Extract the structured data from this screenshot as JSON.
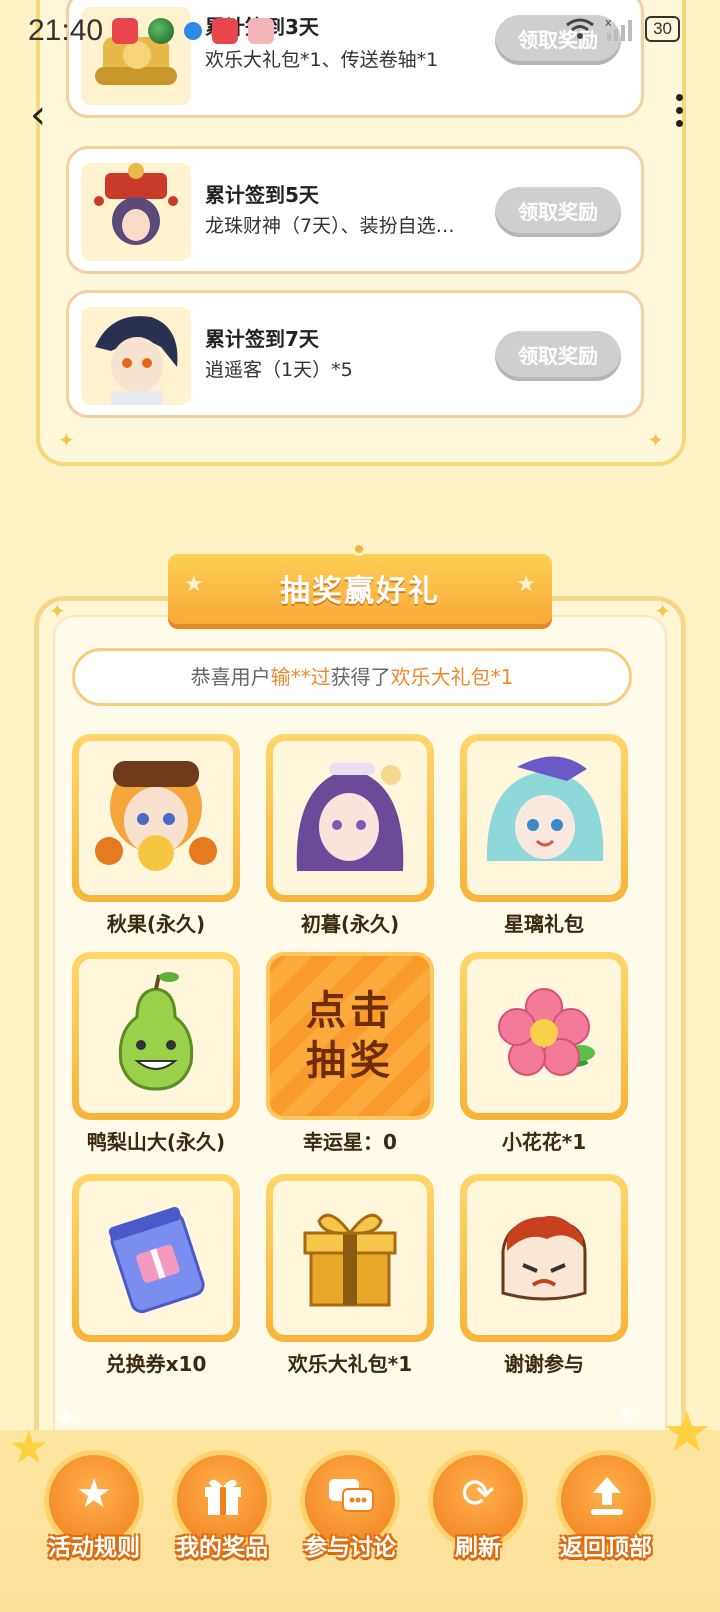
{
  "status_bar": {
    "time": "21:40",
    "battery": "30"
  },
  "signin_cards": [
    {
      "title": "累计签到3天",
      "desc": "欢乐大礼包*1、传送卷轴*1",
      "button": "领取奖励",
      "icon": "scroll-icon"
    },
    {
      "title": "累计签到5天",
      "desc": "龙珠财神（7天）、装扮自选…",
      "button": "领取奖励",
      "icon": "character-avatar"
    },
    {
      "title": "累计签到7天",
      "desc": "逍遥客（1天）*5",
      "button": "领取奖励",
      "icon": "character-avatar"
    }
  ],
  "lottery": {
    "banner_title": "抽奖赢好礼",
    "winner": {
      "prefix": "恭喜用户",
      "user": "输**过",
      "middle": "获得了",
      "prize": "欢乐大礼包*1"
    },
    "draw_button": {
      "line1": "点击",
      "line2": "抽奖"
    },
    "lucky_star_label": "幸运星：0",
    "prizes": [
      {
        "label": "秋果(永久)",
        "icon": "character-avatar"
      },
      {
        "label": "初暮(永久)",
        "icon": "character-avatar"
      },
      {
        "label": "星璃礼包",
        "icon": "character-avatar"
      },
      {
        "label": "鸭梨山大(永久)",
        "icon": "pear-icon"
      },
      {
        "label": "小花花*1",
        "icon": "flower-icon"
      },
      {
        "label": "兑换券x10",
        "icon": "ticket-icon"
      },
      {
        "label": "欢乐大礼包*1",
        "icon": "gift-box-icon"
      },
      {
        "label": "谢谢参与",
        "icon": "thanks-face-icon"
      }
    ]
  },
  "bottom_nav": [
    {
      "label": "活动规则",
      "icon": "star-icon"
    },
    {
      "label": "我的奖品",
      "icon": "gift-icon"
    },
    {
      "label": "参与讨论",
      "icon": "chat-icon"
    },
    {
      "label": "刷新",
      "icon": "refresh-icon"
    },
    {
      "label": "返回顶部",
      "icon": "upload-icon"
    }
  ],
  "colors": {
    "background": "#fdf3c6",
    "accent": "#f7b43a",
    "highlight": "#f08a2a",
    "disabled_button": "#cfcfcf"
  }
}
